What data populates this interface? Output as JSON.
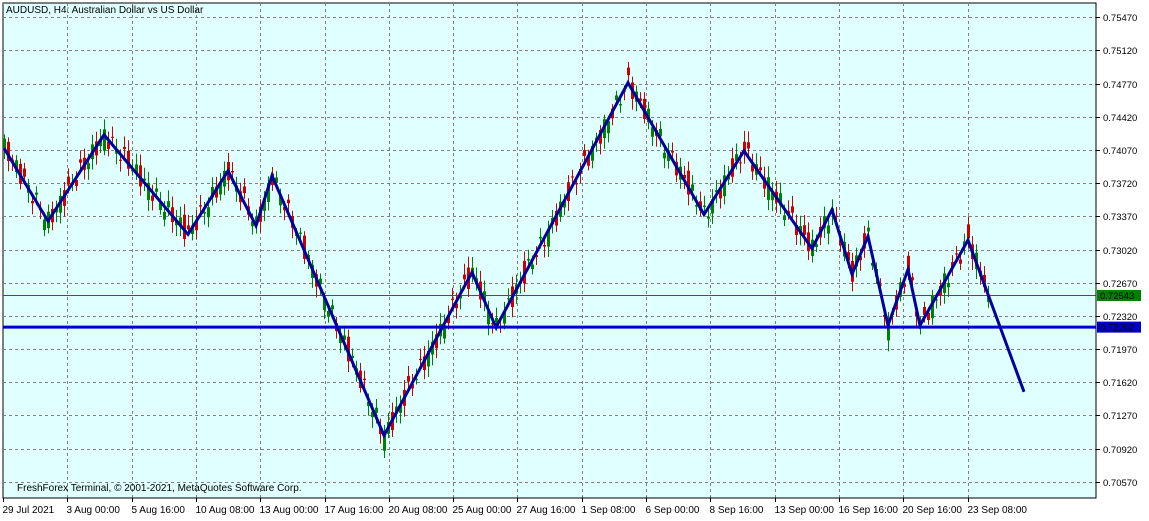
{
  "window": {
    "title": "AUDUSD, H4:  Australian Dollar vs US Dollar",
    "copyright": "FreshForex Terminal, © 2001-2021, MetaQuotes Software Corp."
  },
  "colors": {
    "background": "#e0ffff",
    "grid": "#808080",
    "zigzag": "#00009c",
    "horizontal_line": "#0000c8",
    "bid_line": "#008000",
    "bull_candle": "#008000",
    "bear_candle": "#cc0000"
  },
  "chart_data": {
    "type": "candlestick",
    "symbol": "AUDUSD",
    "timeframe": "H4",
    "title": "AUDUSD, H4:  Australian Dollar vs US Dollar",
    "ylim": [
      0.704,
      0.7562
    ],
    "price_ticks": [
      "0.75470",
      "0.75120",
      "0.74770",
      "0.74420",
      "0.74070",
      "0.73720",
      "0.73370",
      "0.73020",
      "0.72670",
      "0.72320",
      "0.71970",
      "0.71620",
      "0.71270",
      "0.70920",
      "0.70570"
    ],
    "time_ticks": [
      "29 Jul 2021",
      "3 Aug 00:00",
      "5 Aug 16:00",
      "10 Aug 08:00",
      "13 Aug 00:00",
      "17 Aug 16:00",
      "20 Aug 08:00",
      "25 Aug 00:00",
      "27 Aug 16:00",
      "1 Sep 08:00",
      "6 Sep 00:00",
      "8 Sep 16:00",
      "13 Sep 00:00",
      "16 Sep 16:00",
      "20 Sep 16:00",
      "23 Sep 08:00"
    ],
    "current_price": {
      "label": "0.72543",
      "value": 0.72543
    },
    "level_line": {
      "label": "0.72202",
      "value": 0.72202
    },
    "zigzag": [
      {
        "bar": 0,
        "price": 0.7409
      },
      {
        "bar": 11,
        "price": 0.7332
      },
      {
        "bar": 25,
        "price": 0.7423
      },
      {
        "bar": 46,
        "price": 0.7318
      },
      {
        "bar": 56,
        "price": 0.7385
      },
      {
        "bar": 63,
        "price": 0.7327
      },
      {
        "bar": 67,
        "price": 0.738
      },
      {
        "bar": 95,
        "price": 0.7106
      },
      {
        "bar": 117,
        "price": 0.7278
      },
      {
        "bar": 123,
        "price": 0.722
      },
      {
        "bar": 156,
        "price": 0.7478
      },
      {
        "bar": 175,
        "price": 0.7339
      },
      {
        "bar": 185,
        "price": 0.7406
      },
      {
        "bar": 202,
        "price": 0.7303
      },
      {
        "bar": 207,
        "price": 0.7344
      },
      {
        "bar": 212,
        "price": 0.7276
      },
      {
        "bar": 216,
        "price": 0.7316
      },
      {
        "bar": 221,
        "price": 0.7222
      },
      {
        "bar": 226,
        "price": 0.7281
      },
      {
        "bar": 229,
        "price": 0.7222
      },
      {
        "bar": 241,
        "price": 0.7312
      },
      {
        "bar": 255,
        "price": 0.7152
      }
    ],
    "last_candle_bar": 246
  }
}
